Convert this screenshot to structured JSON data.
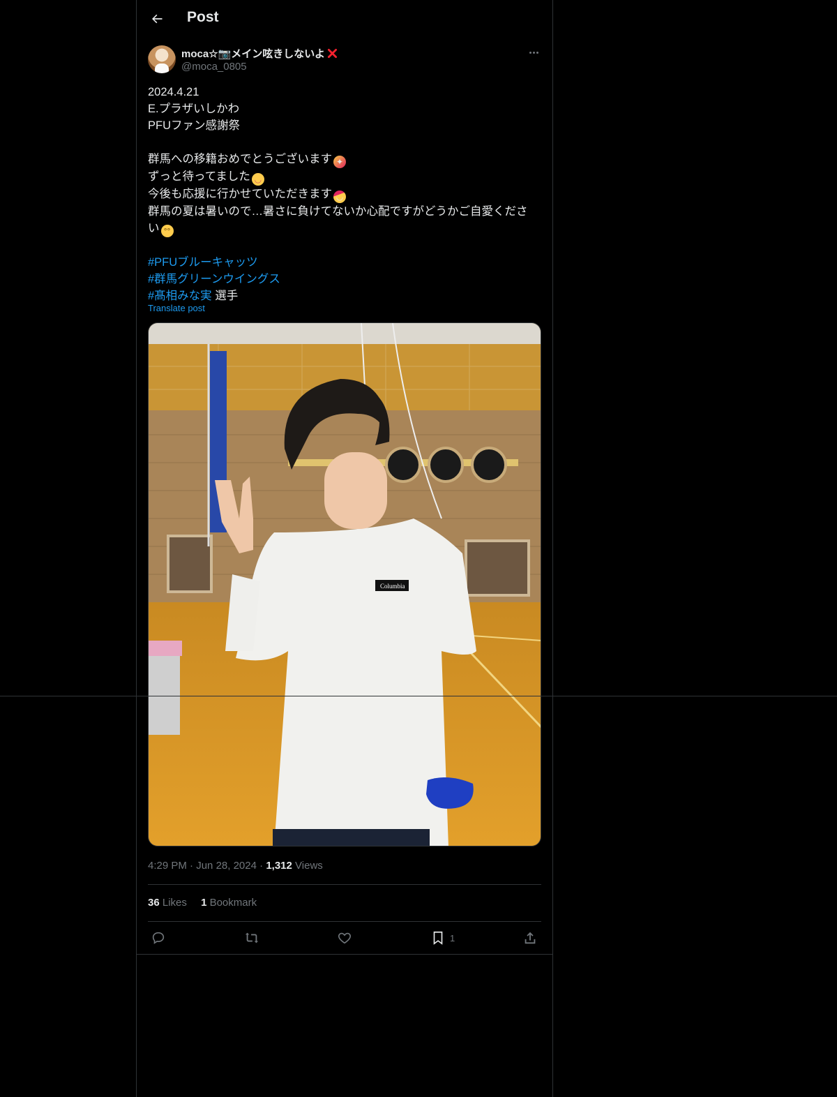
{
  "header": {
    "title": "Post",
    "back_icon": "arrow-left-icon"
  },
  "author": {
    "display_name": "moca☆📷メイン呟きしないよ",
    "name_icon": "cross-mark-icon",
    "handle": "@moca_0805"
  },
  "post": {
    "lines": [
      "2024.4.21",
      "E.プラザいしかわ",
      "PFUファン感謝祭",
      "群馬への移籍おめでとうございます",
      "ずっと待ってました",
      "今後も応援に行かせていただきます",
      "群馬の夏は暑いので…暑さに負けてないか心配ですがどうかご自愛くださ",
      "い"
    ],
    "hashtags": [
      "#PFUブルーキャッツ",
      "#群馬グリーンウイングス",
      "#髙相みな実"
    ],
    "hashtag_suffix": " 選手",
    "translate_label": "Translate post",
    "emoji_icons": [
      "party-popper-icon",
      "smiling-blush-icon",
      "partying-face-icon",
      "pleading-face-icon"
    ]
  },
  "meta": {
    "time": "4:29 PM",
    "date": "Jun 28, 2024",
    "sep": "·",
    "views_count": "1,312",
    "views_label": "Views"
  },
  "stats": {
    "likes_count": "36",
    "likes_label": "Likes",
    "bookmarks_count": "1",
    "bookmarks_label": "Bookmark"
  },
  "actions": {
    "reply_icon": "reply-icon",
    "repost_icon": "repost-icon",
    "like_icon": "heart-icon",
    "bookmark_icon": "bookmark-icon",
    "bookmark_count": "1",
    "share_icon": "share-icon"
  },
  "colors": {
    "accent": "#1d9bf0",
    "muted": "#71767b",
    "text": "#e7e9ea",
    "border": "#2f3336"
  }
}
